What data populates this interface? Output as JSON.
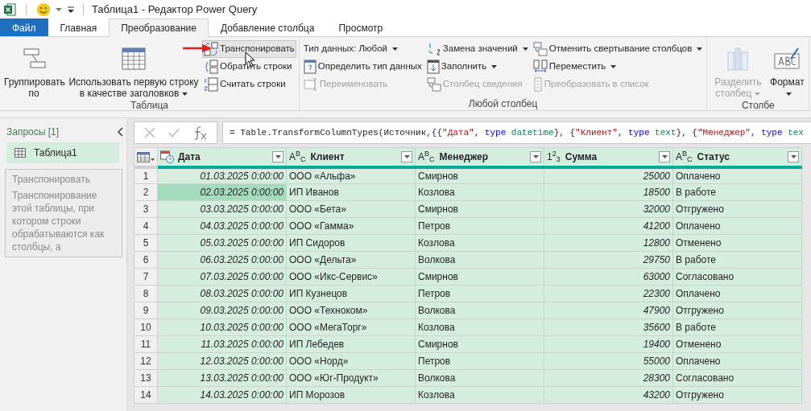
{
  "window": {
    "title": "Таблица1 - Редактор Power Query"
  },
  "tabs": [
    {
      "label": "Файл",
      "kind": "file",
      "selected": false
    },
    {
      "label": "Главная",
      "kind": "tab",
      "selected": false
    },
    {
      "label": "Преобразование",
      "kind": "tab",
      "selected": true
    },
    {
      "label": "Добавление столбца",
      "kind": "tab",
      "selected": false
    },
    {
      "label": "Просмотр",
      "kind": "tab",
      "selected": false
    }
  ],
  "ribbon": {
    "groups": [
      {
        "label": "Таблица",
        "columns": [
          {
            "kind": "large",
            "items": [
              {
                "label": "Группировать по",
                "dropdown": false,
                "disabled": false,
                "hovered": false
              }
            ]
          },
          {
            "kind": "large",
            "items": [
              {
                "label": "Использовать первую строку в качестве заголовков",
                "dropdown": true,
                "disabled": false,
                "hovered": false
              }
            ]
          },
          {
            "kind": "small",
            "items": [
              {
                "label": "Транспонировать",
                "dropdown": false,
                "disabled": false,
                "hovered": true
              },
              {
                "label": "Обратить строки",
                "dropdown": false,
                "disabled": false,
                "hovered": false
              },
              {
                "label": "Считать строки",
                "dropdown": false,
                "disabled": false,
                "hovered": false
              }
            ]
          }
        ]
      },
      {
        "label": "Любой столбец",
        "columns": [
          {
            "kind": "small",
            "items": [
              {
                "label": "Тип данных: Любой",
                "dropdown": true,
                "disabled": false,
                "hovered": false
              },
              {
                "label": "Определить тип данных",
                "dropdown": false,
                "disabled": false,
                "hovered": false
              },
              {
                "label": "Переименовать",
                "dropdown": false,
                "disabled": true,
                "hovered": false
              }
            ]
          },
          {
            "kind": "small",
            "items": [
              {
                "label": "Замена значений",
                "dropdown": true,
                "disabled": false,
                "hovered": false
              },
              {
                "label": "Заполнить",
                "dropdown": true,
                "disabled": false,
                "hovered": false
              },
              {
                "label": "Столбец сведения",
                "dropdown": false,
                "disabled": true,
                "hovered": false
              }
            ]
          },
          {
            "kind": "small",
            "items": [
              {
                "label": "Отменить свертывание столбцов",
                "dropdown": true,
                "disabled": false,
                "hovered": false
              },
              {
                "label": "Переместить",
                "dropdown": true,
                "disabled": false,
                "hovered": false
              },
              {
                "label": "Преобразовать в список",
                "dropdown": false,
                "disabled": true,
                "hovered": false
              }
            ]
          }
        ]
      },
      {
        "label": "Столбе",
        "columns": [
          {
            "kind": "large",
            "items": [
              {
                "label": "Разделить столбец",
                "dropdown": true,
                "disabled": true,
                "hovered": false
              }
            ]
          },
          {
            "kind": "large",
            "items": [
              {
                "label": "Формат",
                "dropdown": true,
                "disabled": false,
                "hovered": false
              }
            ]
          }
        ]
      }
    ]
  },
  "annotation": {
    "kind": "arrow"
  },
  "tooltip": {
    "title": "Транспонировать",
    "text": "Транспонирование этой таблицы, при котором строки обрабатываются как столбцы, а"
  },
  "queries": {
    "title": "Запросы [1]",
    "items": [
      {
        "label": "Таблица1",
        "selected": true
      }
    ]
  },
  "formula": {
    "tokens": [
      {
        "text": "= Table.TransformColumnTypes(Источник,{{",
        "kind": "plain"
      },
      {
        "text": "\"Дата\"",
        "kind": "string"
      },
      {
        "text": ", type",
        "kind": "keyword"
      },
      {
        "text": " datetime",
        "kind": "type"
      },
      {
        "text": "}, {",
        "kind": "plain"
      },
      {
        "text": "\"Клиент\"",
        "kind": "string"
      },
      {
        "text": ", type",
        "kind": "keyword"
      },
      {
        "text": " text",
        "kind": "type"
      },
      {
        "text": "}, {",
        "kind": "plain"
      },
      {
        "text": "\"Менеджер\"",
        "kind": "string"
      },
      {
        "text": ", type",
        "kind": "keyword"
      },
      {
        "text": " tex",
        "kind": "type"
      }
    ]
  },
  "table": {
    "columns": [
      {
        "name": "Дата",
        "kind": "datetime"
      },
      {
        "name": "Клиент",
        "kind": "text",
        "type_label": "A$^{B}$$_{C}$"
      },
      {
        "name": "Менеджер",
        "kind": "text",
        "type_label": "A$^{B}$$_{C}$"
      },
      {
        "name": "Сумма",
        "kind": "number",
        "type_label": "1$^{2}$$_{3}$"
      },
      {
        "name": "Статус",
        "kind": "text",
        "type_label": "A$^{B}$$_{C}$"
      }
    ],
    "rows": [
      {
        "number": "1",
        "cells": [
          {
            "text": "01.03.2025 0:00:00",
            "selected": false
          },
          {
            "text": "ООО «Альфа»",
            "selected": false
          },
          {
            "text": "Смирнов",
            "selected": false
          },
          {
            "text": "25000",
            "selected": false
          },
          {
            "text": "Оплачено",
            "selected": false
          }
        ]
      },
      {
        "number": "2",
        "cells": [
          {
            "text": "02.03.2025 0:00:00",
            "selected": true
          },
          {
            "text": "ИП Иванов",
            "selected": false
          },
          {
            "text": "Козлова",
            "selected": false
          },
          {
            "text": "18500",
            "selected": false
          },
          {
            "text": "В работе",
            "selected": false
          }
        ]
      },
      {
        "number": "3",
        "cells": [
          {
            "text": "03.03.2025 0:00:00",
            "selected": false
          },
          {
            "text": "ООО «Бета»",
            "selected": false
          },
          {
            "text": "Смирнов",
            "selected": false
          },
          {
            "text": "32000",
            "selected": false
          },
          {
            "text": "Отгружено",
            "selected": false
          }
        ]
      },
      {
        "number": "4",
        "cells": [
          {
            "text": "04.03.2025 0:00:00",
            "selected": false
          },
          {
            "text": "ООО «Гамма»",
            "selected": false
          },
          {
            "text": "Петров",
            "selected": false
          },
          {
            "text": "41200",
            "selected": false
          },
          {
            "text": "Оплачено",
            "selected": false
          }
        ]
      },
      {
        "number": "5",
        "cells": [
          {
            "text": "05.03.2025 0:00:00",
            "selected": false
          },
          {
            "text": "ИП Сидоров",
            "selected": false
          },
          {
            "text": "Козлова",
            "selected": false
          },
          {
            "text": "12800",
            "selected": false
          },
          {
            "text": "Отменено",
            "selected": false
          }
        ]
      },
      {
        "number": "6",
        "cells": [
          {
            "text": "06.03.2025 0:00:00",
            "selected": false
          },
          {
            "text": "ООО «Дельта»",
            "selected": false
          },
          {
            "text": "Волкова",
            "selected": false
          },
          {
            "text": "29750",
            "selected": false
          },
          {
            "text": "В работе",
            "selected": false
          }
        ]
      },
      {
        "number": "7",
        "cells": [
          {
            "text": "07.03.2025 0:00:00",
            "selected": false
          },
          {
            "text": "ООО «Икс-Сервис»",
            "selected": false
          },
          {
            "text": "Смирнов",
            "selected": false
          },
          {
            "text": "63000",
            "selected": false
          },
          {
            "text": "Согласовано",
            "selected": false
          }
        ]
      },
      {
        "number": "8",
        "cells": [
          {
            "text": "08.03.2025 0:00:00",
            "selected": false
          },
          {
            "text": "ИП Кузнецов",
            "selected": false
          },
          {
            "text": "Петров",
            "selected": false
          },
          {
            "text": "22300",
            "selected": false
          },
          {
            "text": "Оплачено",
            "selected": false
          }
        ]
      },
      {
        "number": "9",
        "cells": [
          {
            "text": "09.03.2025 0:00:00",
            "selected": false
          },
          {
            "text": "ООО «Техноком»",
            "selected": false
          },
          {
            "text": "Волкова",
            "selected": false
          },
          {
            "text": "47900",
            "selected": false
          },
          {
            "text": "Отгружено",
            "selected": false
          }
        ]
      },
      {
        "number": "10",
        "cells": [
          {
            "text": "10.03.2025 0:00:00",
            "selected": false
          },
          {
            "text": "ООО «МегаТорг»",
            "selected": false
          },
          {
            "text": "Козлова",
            "selected": false
          },
          {
            "text": "35600",
            "selected": false
          },
          {
            "text": "В работе",
            "selected": false
          }
        ]
      },
      {
        "number": "11",
        "cells": [
          {
            "text": "11.03.2025 0:00:00",
            "selected": false
          },
          {
            "text": "ИП Лебедев",
            "selected": false
          },
          {
            "text": "Смирнов",
            "selected": false
          },
          {
            "text": "19400",
            "selected": false
          },
          {
            "text": "Отменено",
            "selected": false
          }
        ]
      },
      {
        "number": "12",
        "cells": [
          {
            "text": "12.03.2025 0:00:00",
            "selected": false
          },
          {
            "text": "ООО «Норд»",
            "selected": false
          },
          {
            "text": "Петров",
            "selected": false
          },
          {
            "text": "55000",
            "selected": false
          },
          {
            "text": "Оплачено",
            "selected": false
          }
        ]
      },
      {
        "number": "13",
        "cells": [
          {
            "text": "13.03.2025 0:00:00",
            "selected": false
          },
          {
            "text": "ООО «Юг-Продукт»",
            "selected": false
          },
          {
            "text": "Волкова",
            "selected": false
          },
          {
            "text": "28300",
            "selected": false
          },
          {
            "text": "Согласовано",
            "selected": false
          }
        ]
      },
      {
        "number": "14",
        "cells": [
          {
            "text": "14.03.2025 0:00:00",
            "selected": false
          },
          {
            "text": "ИП Морозов",
            "selected": false
          },
          {
            "text": "Козлова",
            "selected": false
          },
          {
            "text": "43200",
            "selected": false
          },
          {
            "text": "Отгружено",
            "selected": false
          }
        ]
      }
    ]
  }
}
